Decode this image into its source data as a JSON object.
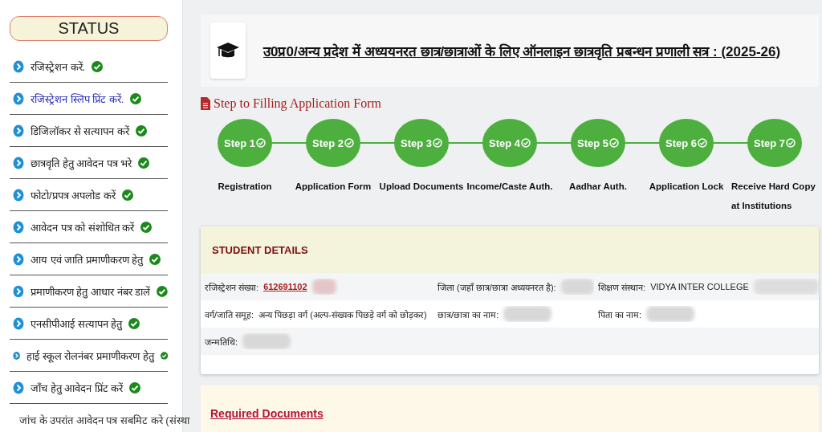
{
  "sidebar": {
    "title": "STATUS",
    "items": [
      {
        "label": "रजिस्ट्रेशन करें.",
        "done": true,
        "selected": false
      },
      {
        "label": "रजिस्ट्रेशन स्लिप प्रिंट करें.",
        "done": true,
        "selected": true
      },
      {
        "label": "डिजिलॉकर से सत्यापन करें",
        "done": true,
        "selected": false
      },
      {
        "label": "छात्रवृति हेतु आवेदन पत्र भरे",
        "done": true,
        "selected": false
      },
      {
        "label": "फोटो/प्रपत्र अपलोड करें",
        "done": true,
        "selected": false
      },
      {
        "label": "आवेदन पत्र को संशोधित करें",
        "done": true,
        "selected": false
      },
      {
        "label": "आय एवं जाति प्रमाणीकरण हेतु",
        "done": true,
        "selected": false
      },
      {
        "label": "प्रमाणीकरण हेतु आधार नंबर डालें",
        "done": true,
        "selected": false
      },
      {
        "label": "एनसीपीआई सत्यापन हेतु",
        "done": true,
        "selected": false
      },
      {
        "label": "हाई स्कूल रोलनंबर प्रमाणीकरण हेतु",
        "done": true,
        "selected": false
      },
      {
        "label": "जाँच हेतु आवेदन प्रिंट करें",
        "done": true,
        "selected": false
      },
      {
        "label": "जांच के उपरांत आवेदन पत्र सबमिट करे (संस्था",
        "done": false,
        "selected": false
      }
    ]
  },
  "header": {
    "title": "उ0प्र0/अन्य प्रदेश में अध्ययनरत छात्र/छात्राओं के लिए ऑनलाइन छात्रवृति प्रबन्धन प्रणाली सत्र : (2025-26)"
  },
  "steps_heading": "Step to Filling Application Form",
  "steps": [
    {
      "badge": "Step 1",
      "label": "Registration",
      "done": true
    },
    {
      "badge": "Step 2",
      "label": "Application Form",
      "done": true
    },
    {
      "badge": "Step 3",
      "label": "Upload Documents",
      "done": true
    },
    {
      "badge": "Step 4",
      "label": "Income/Caste Auth.",
      "done": true
    },
    {
      "badge": "Step 5",
      "label": "Aadhar Auth.",
      "done": true
    },
    {
      "badge": "Step 6",
      "label": "Application Lock",
      "done": true
    },
    {
      "badge": "Step 7",
      "label": "Receive Hard Copy at Institutions",
      "done": true
    }
  ],
  "student_details": {
    "title": "STUDENT DETAILS",
    "rows": [
      [
        {
          "label": "रजिस्ट्रेशन संख्या:",
          "value": "612691102",
          "kind": "link",
          "blurred": true
        },
        {
          "label": "जिला (जहाँ छात्र/छात्रा अध्ययनरत है):",
          "blurred": true
        },
        {
          "label": "शिक्षण संस्थान:",
          "value": "VIDYA INTER COLLEGE",
          "blurred": true
        }
      ],
      [
        {
          "label": "वर्ग/जाति समूह:",
          "value": "अन्य पिछड़ा वर्ग (अल्प-संख्यक पिछड़े वर्ग को छोड़कर)",
          "blurred": false
        },
        {
          "label": "छात्र/छात्रा का नाम:",
          "blurred": true
        },
        {
          "label": "पिता का नाम:",
          "blurred": true
        }
      ],
      [
        {
          "label": "जन्मतिथि:",
          "blurred": true
        }
      ]
    ]
  },
  "required_documents": {
    "title": "Required Documents"
  }
}
